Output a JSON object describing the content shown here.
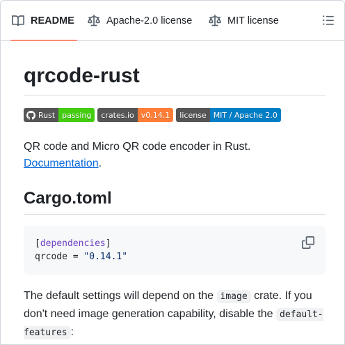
{
  "tabs": [
    {
      "label": "README",
      "icon": "book-icon",
      "active": true
    },
    {
      "label": "Apache-2.0 license",
      "icon": "scale-icon",
      "active": false
    },
    {
      "label": "MIT license",
      "icon": "scale-icon",
      "active": false
    }
  ],
  "outline_icon": "list-icon",
  "readme": {
    "title": "qrcode-rust",
    "badges": [
      {
        "left": "Rust",
        "right": "passing",
        "left_color": "#555555",
        "right_color": "#4c1",
        "icon": "github-icon"
      },
      {
        "left": "crates.io",
        "right": "v0.14.1",
        "left_color": "#555555",
        "right_color": "#fe7d37"
      },
      {
        "left": "license",
        "right": "MIT / Apache 2.0",
        "left_color": "#555555",
        "right_color": "#007ec6"
      }
    ],
    "description": "QR code and Micro QR code encoder in Rust.",
    "docs_link": "Documentation",
    "docs_suffix": ".",
    "cargo_heading": "Cargo.toml",
    "code": {
      "bracket_open": "[",
      "section": "dependencies",
      "bracket_close": "]",
      "key": "qrcode",
      "eq": " = ",
      "value": "\"0.14.1\""
    },
    "copy_icon": "copy-icon",
    "para": {
      "t1": "The default settings will depend on the ",
      "c1": "image",
      "t2": " crate. If you don't need image generation capability, disable the ",
      "c2": "default-features",
      "t3": ":"
    }
  },
  "colors": {
    "accent_underline": "#fd8c73",
    "link": "#0969da"
  }
}
